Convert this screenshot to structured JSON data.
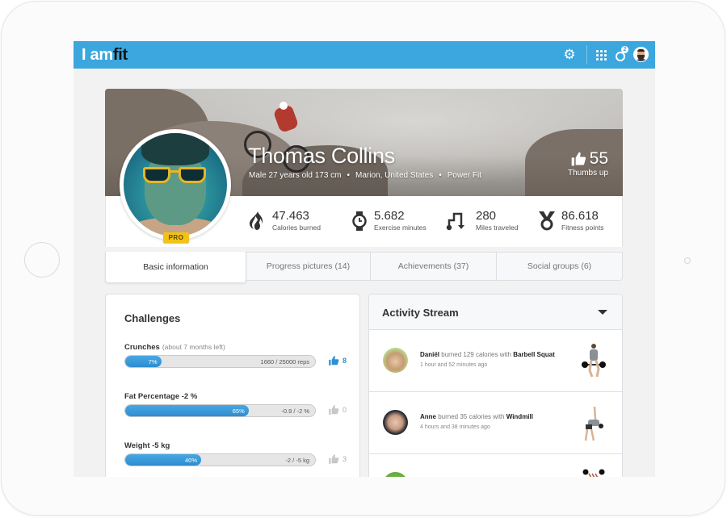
{
  "app": {
    "logo": {
      "part1": "I am",
      "part2": "fit"
    },
    "header_icons": {
      "settings": "gear-icon",
      "apps": "grid-icon",
      "notifications": "notification-icon",
      "notification_count": "2",
      "user": "user-avatar"
    }
  },
  "profile": {
    "name": "Thomas Collins",
    "details": "Male 27 years old 173 cm",
    "location": "Marion, United States",
    "plan": "Power Fit",
    "separator": "•",
    "badge": "PRO",
    "thumbs_up": {
      "count": "55",
      "label": "Thumbs up"
    }
  },
  "stats": [
    {
      "icon": "fire-icon",
      "value": "47.463",
      "label": "Calories burned"
    },
    {
      "icon": "watch-icon",
      "value": "5.682",
      "label": "Exercise minutes"
    },
    {
      "icon": "route-icon",
      "value": "280",
      "label": "Miles traveled"
    },
    {
      "icon": "medal-icon",
      "value": "86.618",
      "label": "Fitness points"
    }
  ],
  "tabs": [
    {
      "label": "Basic information",
      "active": true
    },
    {
      "label": "Progress pictures  (14)",
      "active": false
    },
    {
      "label": "Achievements  (37)",
      "active": false
    },
    {
      "label": "Social groups  (6)",
      "active": false
    }
  ],
  "challenges": {
    "title": "Challenges",
    "items": [
      {
        "title": "Crunches",
        "subtitle": "(about 7 months left)",
        "progress": 7,
        "progress_label": "7%",
        "goal": "1660 / 25000 reps",
        "likes": "8",
        "liked": true
      },
      {
        "title": "Fat Percentage  -2 %",
        "subtitle": "",
        "progress": 65,
        "progress_label": "65%",
        "goal": "-0.9 / -2 %",
        "likes": "0",
        "liked": false
      },
      {
        "title": "Weight -5 kg",
        "subtitle": "",
        "progress": 40,
        "progress_label": "40%",
        "goal": "-2 / -5 kg",
        "likes": "3",
        "liked": false
      }
    ]
  },
  "activity": {
    "title": "Activity Stream",
    "items": [
      {
        "user": "Daniël",
        "action": " burned 129 calories with ",
        "exercise": "Barbell Squat",
        "time": "1 hour and 52 minutes ago"
      },
      {
        "user": "Anne",
        "action": " burned 35 calories with ",
        "exercise": "Windmill",
        "time": "4 hours and 38 minutes ago"
      }
    ]
  },
  "colors": {
    "brand_blue": "#3ba7de",
    "progress_blue": "#2c8cd0",
    "pro_yellow": "#f2c316"
  }
}
